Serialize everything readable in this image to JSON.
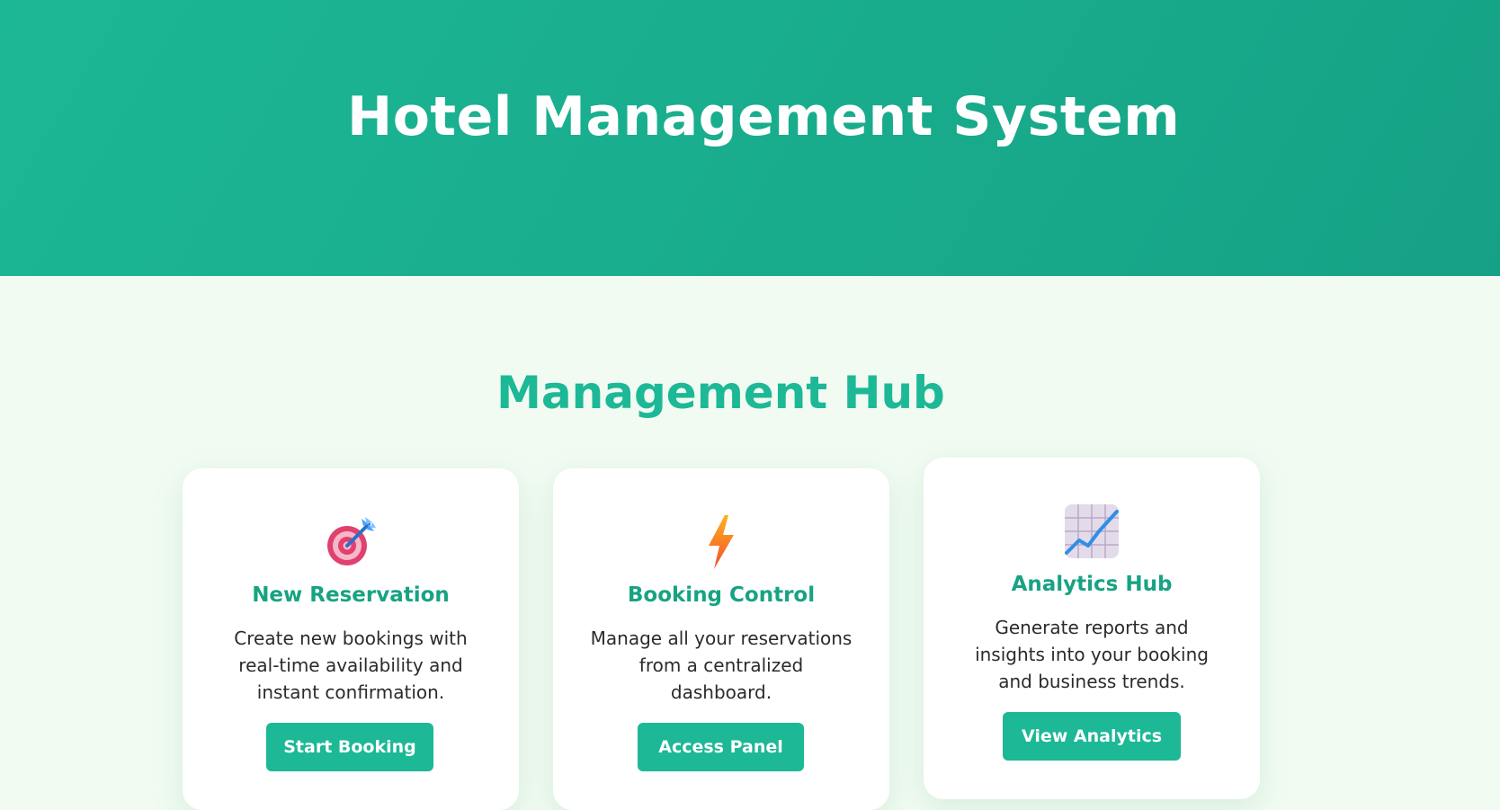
{
  "header": {
    "title": "Hotel Management System"
  },
  "section": {
    "title": "Management Hub"
  },
  "cards": [
    {
      "icon": "target-dart-icon",
      "title": "New Reservation",
      "description": "Create new bookings with real-time availability and instant confirmation.",
      "button_label": "Start Booking"
    },
    {
      "icon": "lightning-bolt-icon",
      "title": "Booking Control",
      "description": "Manage all your reservations from a centralized dashboard.",
      "button_label": "Access Panel"
    },
    {
      "icon": "chart-increasing-icon",
      "title": "Analytics Hub",
      "description": "Generate reports and insights into your booking and business trends.",
      "button_label": "View Analytics"
    }
  ],
  "colors": {
    "header_bg": "#1cb795",
    "page_bg": "#f1fbf2",
    "accent": "#1db896",
    "card_title": "#17a383",
    "text": "#2b2b2b"
  }
}
